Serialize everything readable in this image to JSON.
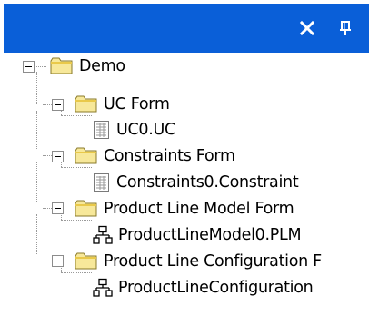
{
  "toolbar": {
    "close_icon": "close-icon",
    "pin_icon": "pin-icon",
    "background": "#0a5fd8"
  },
  "tree": {
    "root": {
      "label": "Demo",
      "icon": "folder-icon",
      "expanded": true
    },
    "nodes": [
      {
        "label": "UC Form",
        "icon": "folder-icon",
        "expanded": true
      },
      {
        "label": "UC0.UC",
        "icon": "document-grid-icon"
      },
      {
        "label": "Constraints Form",
        "icon": "folder-icon",
        "expanded": true
      },
      {
        "label": "Constraints0.Constraint",
        "icon": "document-grid-icon"
      },
      {
        "label": "Product Line Model Form",
        "icon": "folder-icon",
        "expanded": true
      },
      {
        "label": "ProductLineModel0.PLM",
        "icon": "hierarchy-icon"
      },
      {
        "label": "Product Line Configuration F",
        "icon": "folder-icon",
        "expanded": true
      },
      {
        "label": "ProductLineConfiguration",
        "icon": "hierarchy-icon"
      }
    ]
  }
}
